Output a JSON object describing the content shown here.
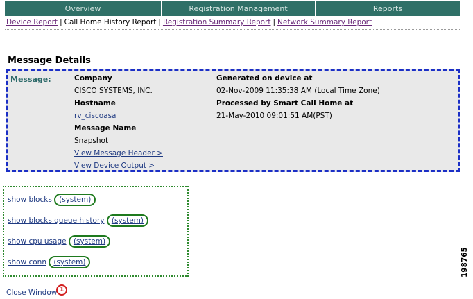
{
  "topnav": {
    "tabs": [
      "Overview",
      "Registration Management",
      "Reports"
    ]
  },
  "subnav": {
    "items": [
      "Device Report",
      "Call Home History Report",
      "Registration Summary Report",
      "Network Summary Report"
    ],
    "separator": "|"
  },
  "page_title": "Message Details",
  "message": {
    "label": "Message:",
    "company_label": "Company",
    "company_value": "CISCO SYSTEMS, INC.",
    "hostname_label": "Hostname",
    "hostname_value": "rv_ciscoasa",
    "message_name_label": "Message Name",
    "message_name_value": "Snapshot",
    "view_header_link": "View Message Header >",
    "view_output_link": "View Device Output >",
    "generated_label": "Generated on device at",
    "generated_value": "02-Nov-2009 11:35:38 AM (Local Time Zone)",
    "processed_label": "Processed by Smart Call Home at",
    "processed_value": "21-May-2010 09:01:51 AM(PST)"
  },
  "commands": [
    {
      "cmd": "show blocks",
      "ctx": "(system)"
    },
    {
      "cmd": "show blocks queue history",
      "ctx": "(system)"
    },
    {
      "cmd": "show cpu usage",
      "ctx": "(system)"
    },
    {
      "cmd": "show conn",
      "ctx": "(system)"
    }
  ],
  "close_window": "Close Window",
  "callout_number": "1",
  "figure_number": "198765",
  "colors": {
    "tab_bg": "#2f7067",
    "message_border": "#1b2fc6",
    "commands_border": "#2f8a2f",
    "callout": "#d22020"
  }
}
